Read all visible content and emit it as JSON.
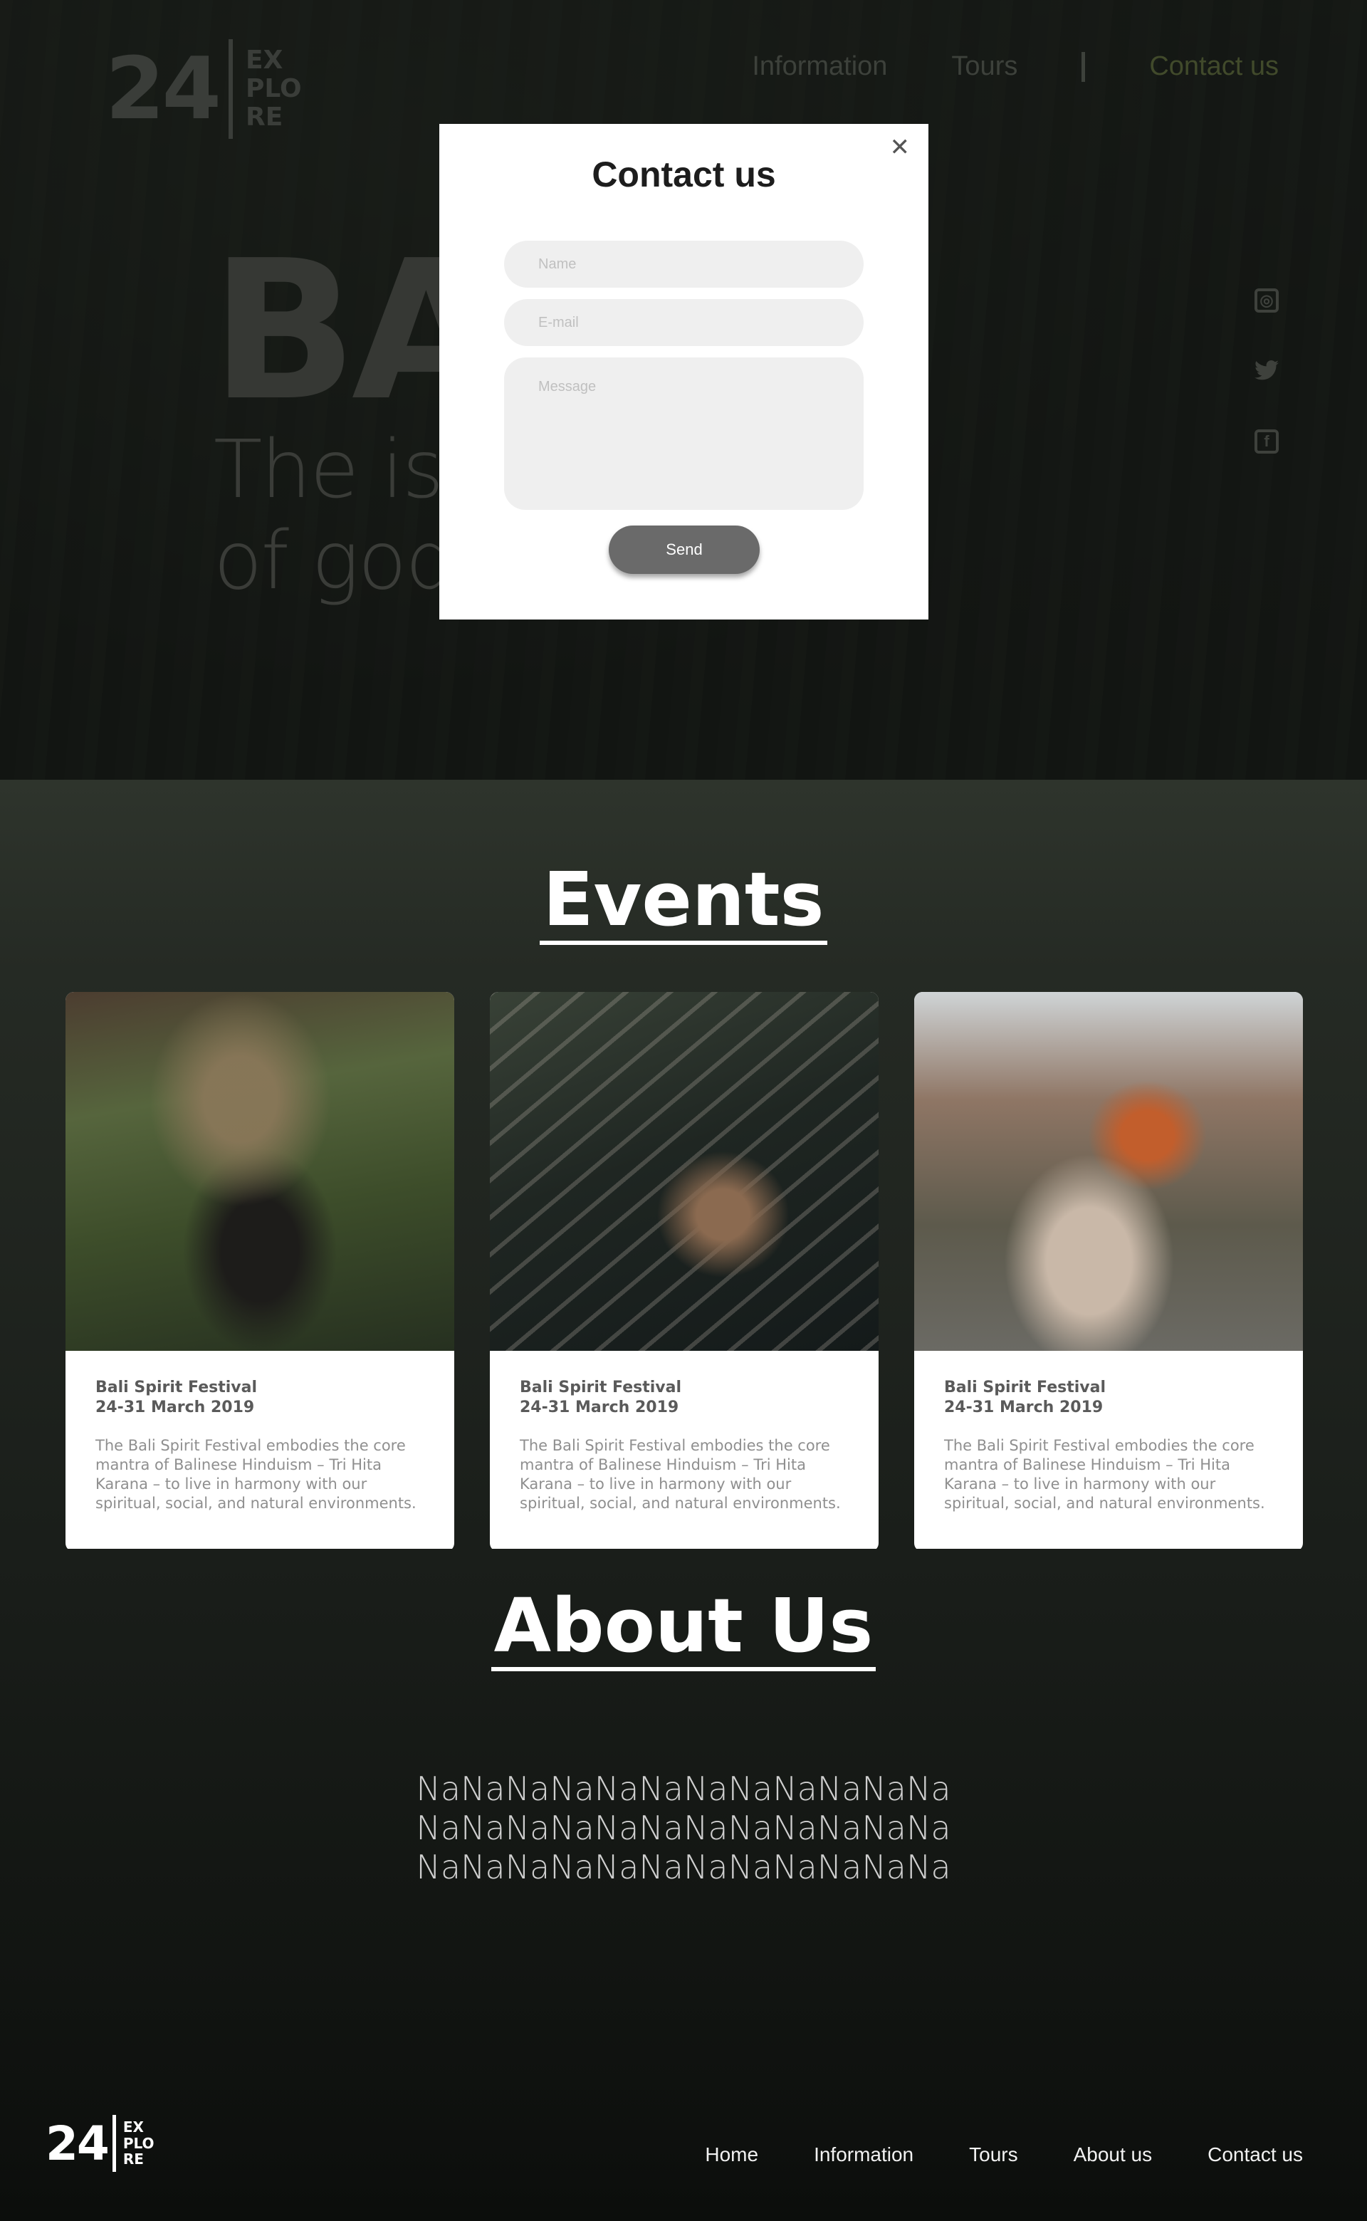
{
  "brand": {
    "number": "24",
    "words": [
      "EX",
      "PLO",
      "RE"
    ]
  },
  "header": {
    "nav": [
      "Information",
      "Tours"
    ],
    "contact": "Contact us"
  },
  "hero": {
    "title": "BA",
    "subtitle_lines": [
      "The isl",
      "of god"
    ]
  },
  "social_icons": [
    "instagram-icon",
    "twitter-icon",
    "facebook-icon"
  ],
  "modal": {
    "title": "Contact us",
    "close_symbol": "✕",
    "name_placeholder": "Name",
    "email_placeholder": "E-mail",
    "message_placeholder": "Message",
    "send_label": "Send"
  },
  "events": {
    "heading": "Events",
    "cards": [
      {
        "title": "Bali Spirit Festival",
        "date": "24-31 March 2019",
        "text": "The Bali Spirit Festival embodies the core mantra of Balinese Hinduism – Tri Hita Karana – to live in harmony with our spiritual, social, and natural environments."
      },
      {
        "title": "Bali Spirit Festival",
        "date": "24-31 March 2019",
        "text": "The Bali Spirit Festival embodies the core mantra of Balinese Hinduism – Tri Hita Karana – to live in harmony with our spiritual, social, and natural environments."
      },
      {
        "title": "Bali Spirit Festival",
        "date": "24-31 March 2019",
        "text": "The Bali Spirit Festival embodies the core mantra of Balinese Hinduism – Tri Hita Karana – to live in harmony with our spiritual, social, and natural environments."
      }
    ]
  },
  "about": {
    "heading": "About Us",
    "lines": [
      "NaNaNaNaNaNaNaNaNaNaNaNa",
      "NaNaNaNaNaNaNaNaNaNaNaNa",
      "NaNaNaNaNaNaNaNaNaNaNaNa"
    ]
  },
  "footer": {
    "nav": [
      "Home",
      "Information",
      "Tours",
      "About us",
      "Contact us"
    ]
  },
  "colors": {
    "modal_bg": "#ffffff",
    "send_button": "#6a6a6a",
    "field_bg": "#efefef"
  }
}
